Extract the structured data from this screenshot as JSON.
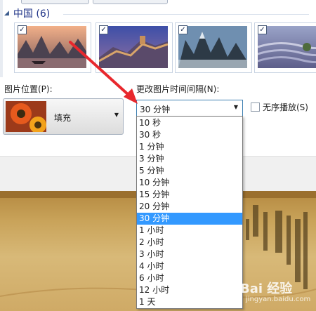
{
  "group": {
    "title": "中国 (6)"
  },
  "thumbnails": [
    {
      "name": "li-river",
      "checked": "✓"
    },
    {
      "name": "great-wall",
      "checked": "✓"
    },
    {
      "name": "mountain-peaks",
      "checked": "✓"
    },
    {
      "name": "rice-terraces",
      "checked": "✓"
    }
  ],
  "position": {
    "label": "图片位置(P):",
    "value": "填充"
  },
  "interval": {
    "label": "更改图片时间间隔(N):",
    "value": "30 分钟",
    "options": [
      "10 秒",
      "30 秒",
      "1 分钟",
      "3 分钟",
      "5 分钟",
      "10 分钟",
      "15 分钟",
      "20 分钟",
      "30 分钟",
      "1 小时",
      "2 小时",
      "3 小时",
      "4 小时",
      "6 小时",
      "12 小时",
      "1 天"
    ],
    "selected_index": 8
  },
  "shuffle": {
    "label": "无序播放(S)"
  },
  "watermark": {
    "text": "Bai 经验",
    "sub": "jingyan.baidu.com"
  },
  "colors": {
    "selection": "#3399ff",
    "arrow": "#e8282d",
    "combo_border": "#3c7fb1"
  }
}
